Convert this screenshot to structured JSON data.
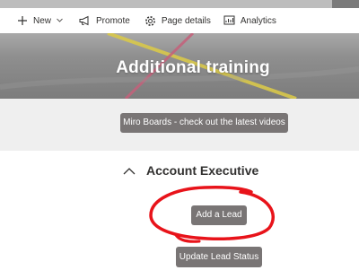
{
  "colors": {
    "button_bg": "#797575",
    "grey_section_bg": "#efefef",
    "annotation_red": "#e8131a",
    "hero_line_yellow": "#d8c84a",
    "hero_line_pink": "#c4607a"
  },
  "commandbar": {
    "new_label": "New",
    "new_icon": "plus-icon",
    "new_dropdown_icon": "chevron-down-icon",
    "promote_label": "Promote",
    "promote_icon": "megaphone-icon",
    "page_details_label": "Page details",
    "page_details_icon": "gear-icon",
    "analytics_label": "Analytics",
    "analytics_icon": "chart-icon"
  },
  "hero": {
    "title": "Additional training"
  },
  "section_links": {
    "miro_button": "Miro Boards - check out the latest videos"
  },
  "collapsible": {
    "heading": "Account Executive",
    "toggle_icon": "chevron-up-icon",
    "buttons": {
      "add_lead": "Add a Lead",
      "update_status": "Update Lead Status"
    }
  },
  "annotation": {
    "type": "hand-drawn red circle around Add a Lead button"
  }
}
